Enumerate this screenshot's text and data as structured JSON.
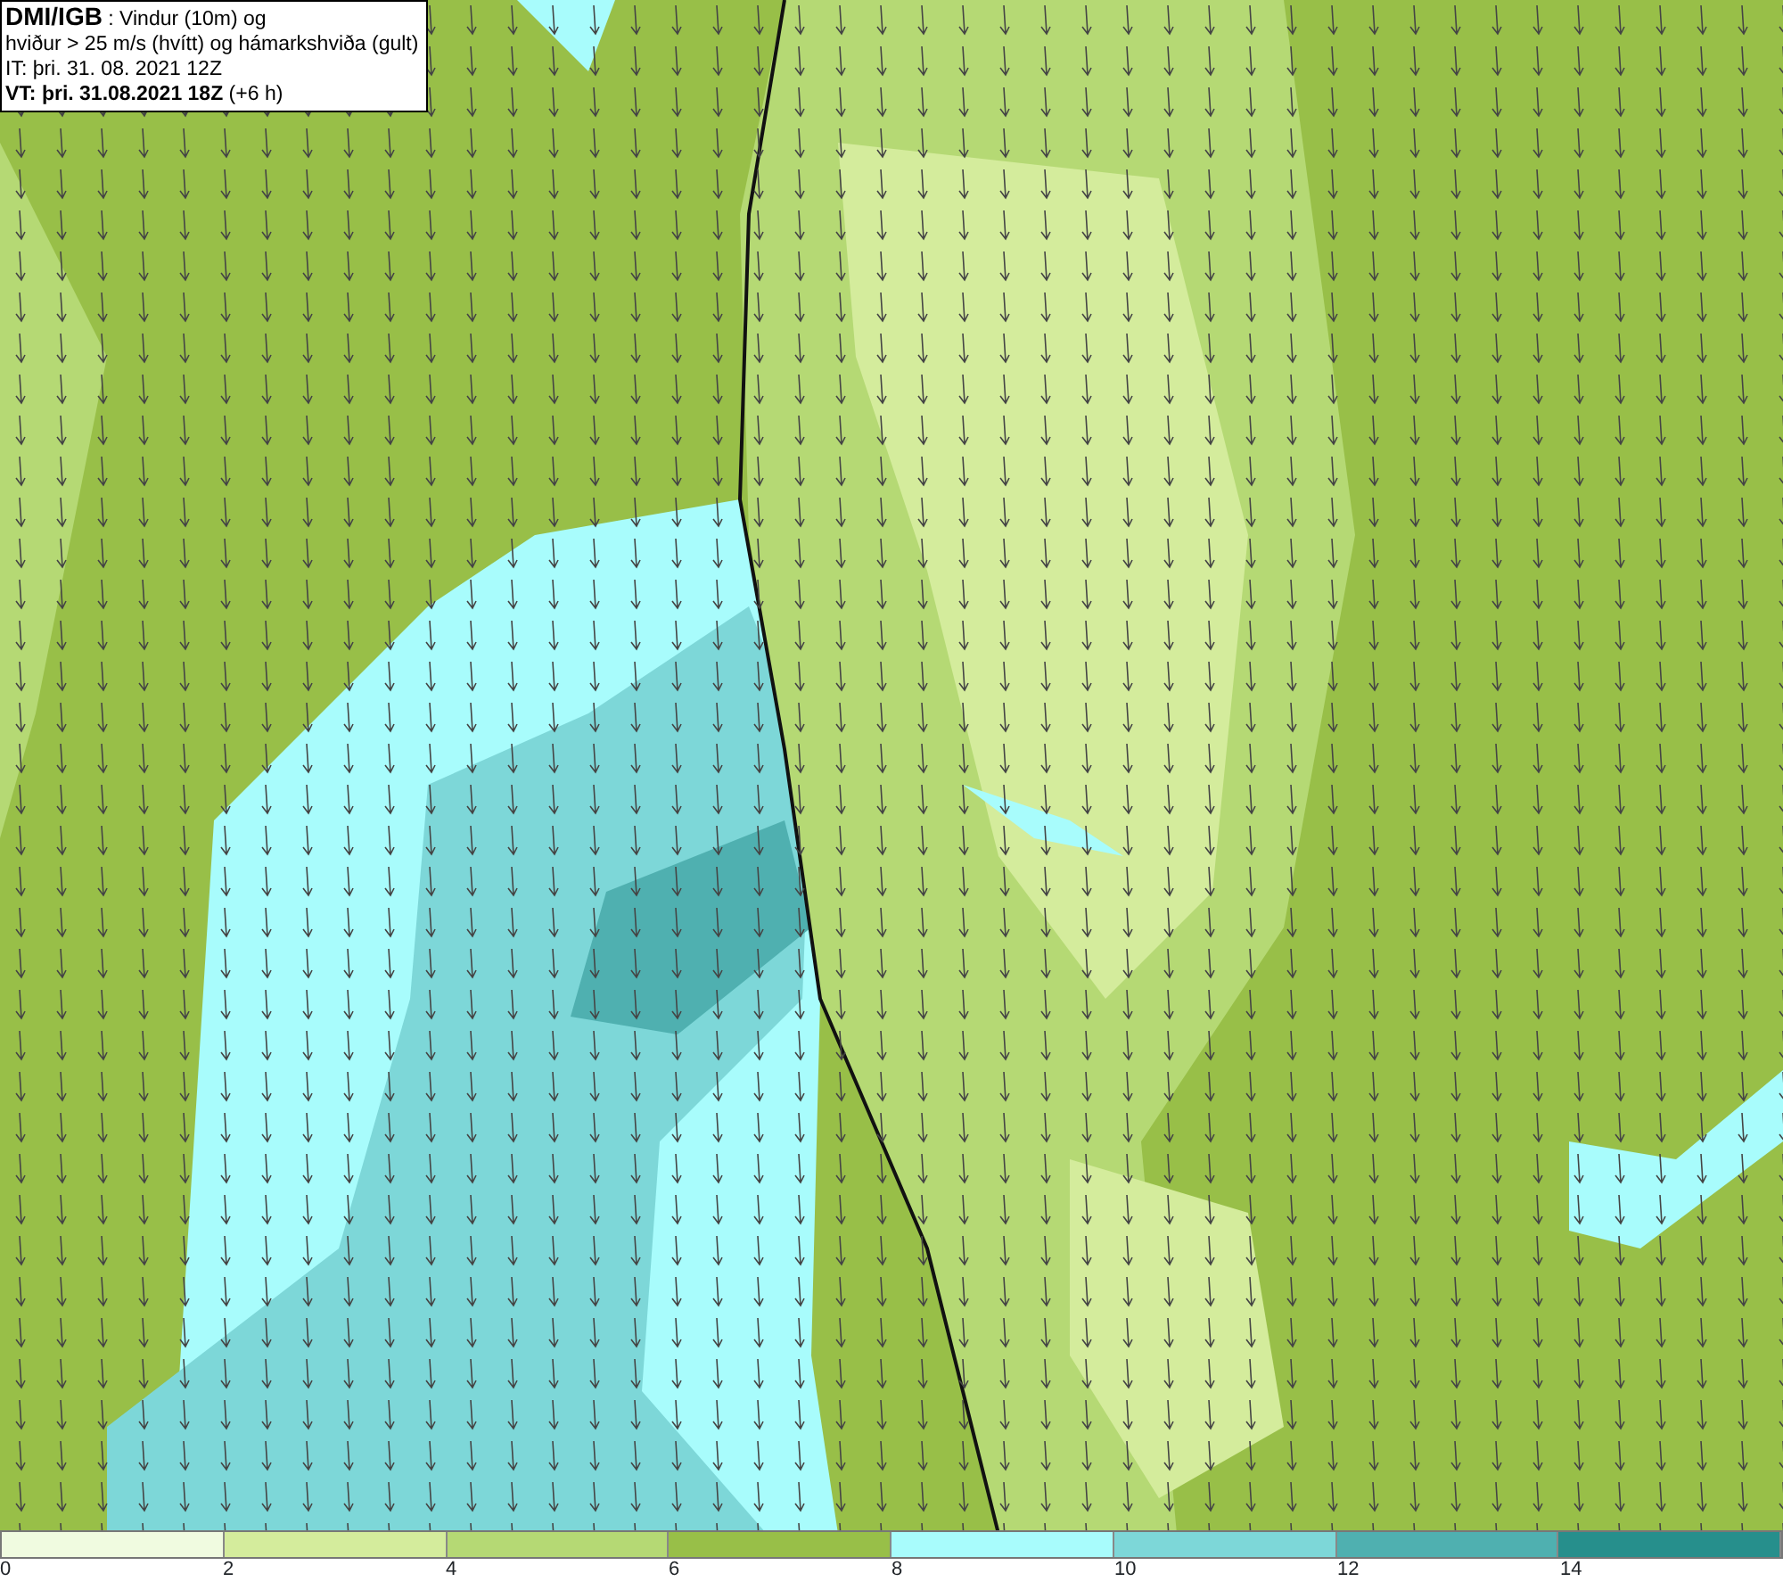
{
  "title_box": {
    "lines": [
      "**DMI/IGB** : Vindur (10m) og",
      "hviður > 25 m/s (hvítt) og hámarkshviða (gult)",
      "IT: þri. 31. 08. 2021 12Z",
      "**VT: þri. 31.08.2021 18Z** (+6 h)"
    ]
  },
  "legend": {
    "bins": [
      {
        "color": "#f0fbe0",
        "label": "0"
      },
      {
        "color": "#d4ec9c",
        "label": "2"
      },
      {
        "color": "#b5d974",
        "label": "4"
      },
      {
        "color": "#98bf48",
        "label": "6"
      },
      {
        "color": "#a8fcfc",
        "label": "8"
      },
      {
        "color": "#7dd7d8",
        "label": "10"
      },
      {
        "color": "#4fb0b0",
        "label": "12"
      },
      {
        "color": "#268f8c",
        "label": "14"
      }
    ]
  }
}
